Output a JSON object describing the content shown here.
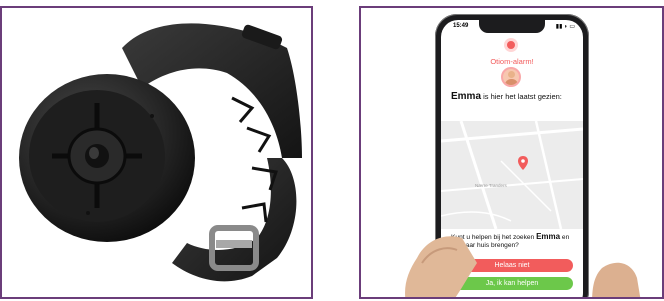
{
  "phone": {
    "time": "15:49",
    "alarm_title": "Otiom-alarm!",
    "seen_name": "Emma",
    "seen_suffix": " is hier het laatst gezien:",
    "map_label": "Nærre Tranders",
    "question_prefix": "Kunt u helpen bij het zoeken ",
    "question_name": "Emma",
    "question_suffix": " en het naar huis brengen?",
    "button_no": "Helaas niet",
    "button_yes": "Ja, ik kan helpen"
  },
  "colors": {
    "frame": "#6b3d7a",
    "alarm_red": "#f25c5c",
    "yes_green": "#6cc84a"
  }
}
